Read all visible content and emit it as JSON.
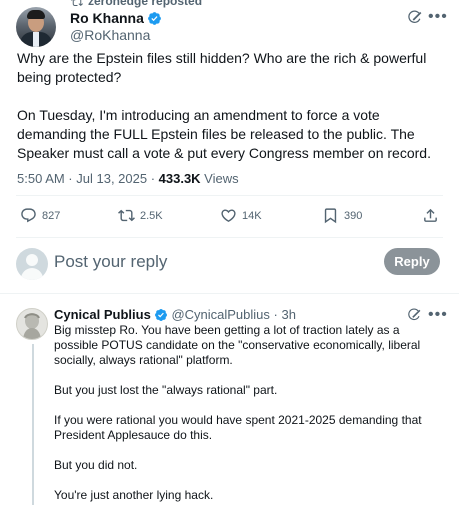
{
  "reposted": {
    "label": "zerohedge reposted"
  },
  "tweet": {
    "author_name": "Ro Khanna",
    "author_handle": "@RoKhanna",
    "paragraphs": [
      "Why are the Epstein files still hidden? Who are the rich & powerful being protected?",
      "On Tuesday, I'm introducing an amendment to force a vote demanding the FULL Epstein files be released to the public. The Speaker must call a vote & put every Congress member on record."
    ],
    "time": "5:50 AM · Jul 13, 2025 · ",
    "views_count": "433.3K",
    "views_label": " Views"
  },
  "actions": {
    "replies": "827",
    "reposts": "2.5K",
    "likes": "14K",
    "bookmarks": "390"
  },
  "reply_box": {
    "placeholder": "Post your reply",
    "button": "Reply"
  },
  "reply": {
    "author_name": "Cynical Publius",
    "author_handle": "@CynicalPublius",
    "time": " · 3h",
    "paragraphs": [
      "Big misstep Ro.  You have been getting a lot of traction lately as a possible POTUS candidate on the \"conservative economically, liberal socially, always rational\" platform.",
      "But you just lost the \"always rational\" part.",
      "If you were rational you would have spent 2021-2025 demanding that President Applesauce do this.",
      "But you did not.",
      "You're just another lying hack."
    ]
  },
  "colors": {
    "verified": "#1d9bf0",
    "secondary_text": "#536471",
    "reply_button": "#8b9399"
  },
  "icons": [
    "repost-icon",
    "verified-badge-icon",
    "grok-icon",
    "more-icon",
    "reply-icon",
    "like-icon",
    "bookmark-icon",
    "share-icon"
  ]
}
